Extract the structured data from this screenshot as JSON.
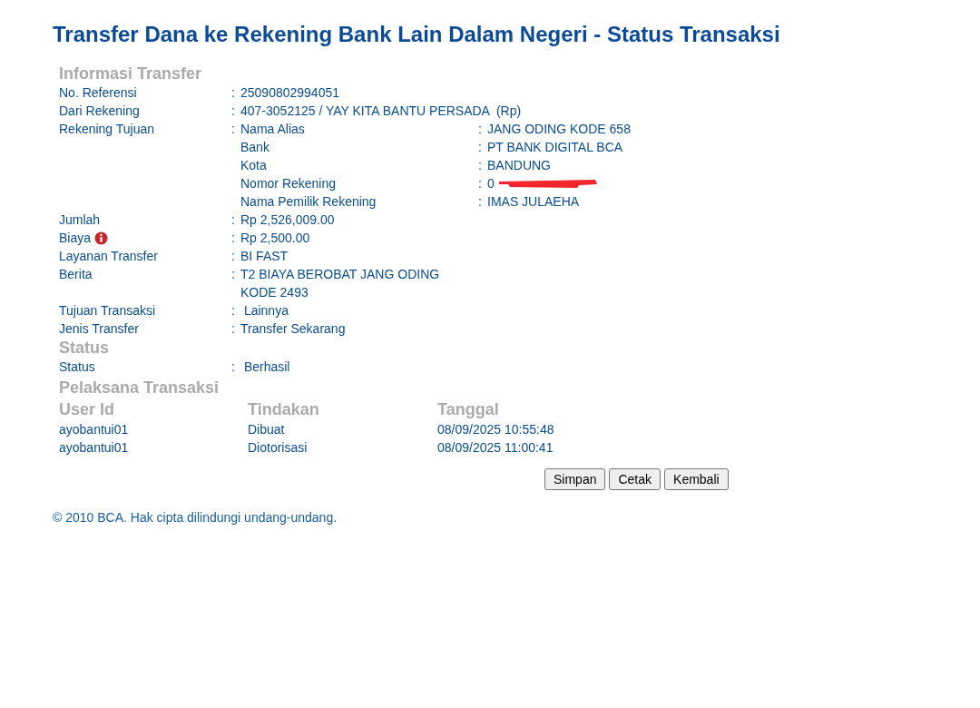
{
  "title": "Transfer Dana ke Rekening Bank Lain Dalam Negeri - Status Transaksi",
  "sections": [
    {
      "heading": "Informasi Transfer",
      "rows": [
        {
          "label": "No. Referensi",
          "sep": ":",
          "value": "25090802994051"
        },
        {
          "label": "Dari Rekening",
          "sep": ":",
          "value": "407-3052125 / YAY KITA BANTU PERSADA  (Rp)"
        },
        {
          "label": "Rekening Tujuan",
          "sep": ":",
          "details": [
            {
              "label": "Nama Alias",
              "sep": ":",
              "value": "JANG ODING KODE 658"
            },
            {
              "label": "Bank",
              "sep": ":",
              "value": "PT BANK DIGITAL BCA"
            },
            {
              "label": "Kota",
              "sep": ":",
              "value": "BANDUNG"
            },
            {
              "label": "Nomor Rekening",
              "sep": ":",
              "value": "0",
              "redacted": true
            },
            {
              "label": "Nama Pemilik Rekening",
              "sep": ":",
              "value": "IMAS JULAEHA"
            }
          ]
        },
        {
          "label": "Jumlah",
          "sep": ":",
          "value": "Rp 2,526,009.00"
        },
        {
          "label": "Biaya",
          "sep": ":",
          "value": "Rp 2,500.00",
          "info": true
        },
        {
          "label": "Layanan Transfer",
          "sep": ":",
          "value": "BI FAST"
        },
        {
          "label": "Berita",
          "sep": ":",
          "lines": [
            "T2 BIAYA BEROBAT JANG ODING",
            "KODE 2493"
          ]
        },
        {
          "label": "Tujuan Transaksi",
          "sep": ":",
          "value": " Lainnya"
        },
        {
          "label": "Jenis Transfer",
          "sep": ":",
          "value": "Transfer Sekarang"
        }
      ]
    },
    {
      "heading": "Status",
      "rows": [
        {
          "label": "Status",
          "sep": ":",
          "value": " Berhasil"
        }
      ]
    }
  ],
  "executors": {
    "heading": "Pelaksana Transaksi",
    "columns": [
      "User Id",
      "Tindakan",
      "Tanggal"
    ],
    "rows": [
      [
        "ayobantui01",
        "Dibuat",
        "08/09/2025 10:55:48"
      ],
      [
        "ayobantui01",
        "Diotorisasi",
        "08/09/2025 11:00:41"
      ]
    ]
  },
  "buttons": [
    "Simpan",
    "Cetak",
    "Kembali"
  ],
  "footer": "©  2010 BCA. Hak cipta dilindungi undang-undang."
}
